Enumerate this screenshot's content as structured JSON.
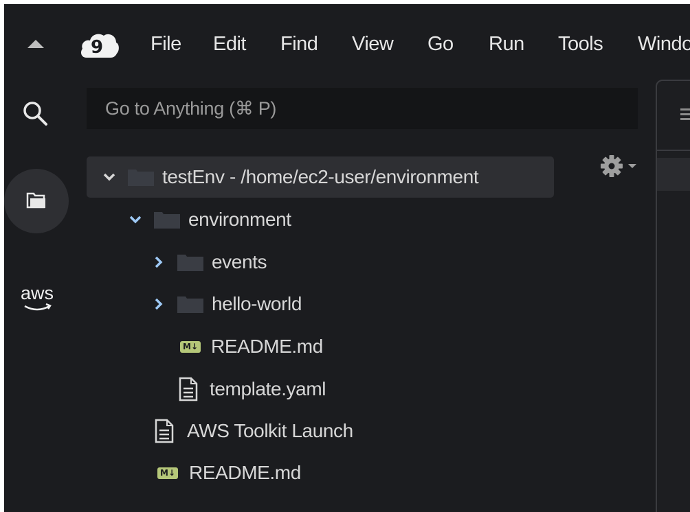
{
  "menubar": {
    "items": [
      "File",
      "Edit",
      "Find",
      "View",
      "Go",
      "Run",
      "Tools",
      "Window"
    ]
  },
  "search": {
    "placeholder": "Go to Anything (⌘ P)"
  },
  "tree": {
    "root": "testEnv - /home/ec2-user/environment",
    "items": [
      {
        "label": "environment",
        "kind": "folder",
        "expanded": true
      },
      {
        "label": "events",
        "kind": "folder",
        "expanded": false
      },
      {
        "label": "hello-world",
        "kind": "folder",
        "expanded": false
      },
      {
        "label": "README.md",
        "kind": "markdown"
      },
      {
        "label": "template.yaml",
        "kind": "file"
      },
      {
        "label": "AWS Toolkit Launch",
        "kind": "file"
      },
      {
        "label": "README.md",
        "kind": "markdown"
      }
    ],
    "md_badge": "M↓"
  },
  "rail": {
    "aws_label": "aws"
  },
  "icons": {
    "collapse": "triangle-up-icon",
    "logo": "cloud9-logo-icon",
    "search": "search-icon",
    "files": "files-icon",
    "aws": "aws-icon",
    "gear": "gear-icon"
  },
  "colors": {
    "background": "#1b1c1f",
    "selected_row": "#2e2f33",
    "folder": "#3a3d44",
    "markdown_badge": "#b5c779",
    "text": "#d7d7d7"
  }
}
